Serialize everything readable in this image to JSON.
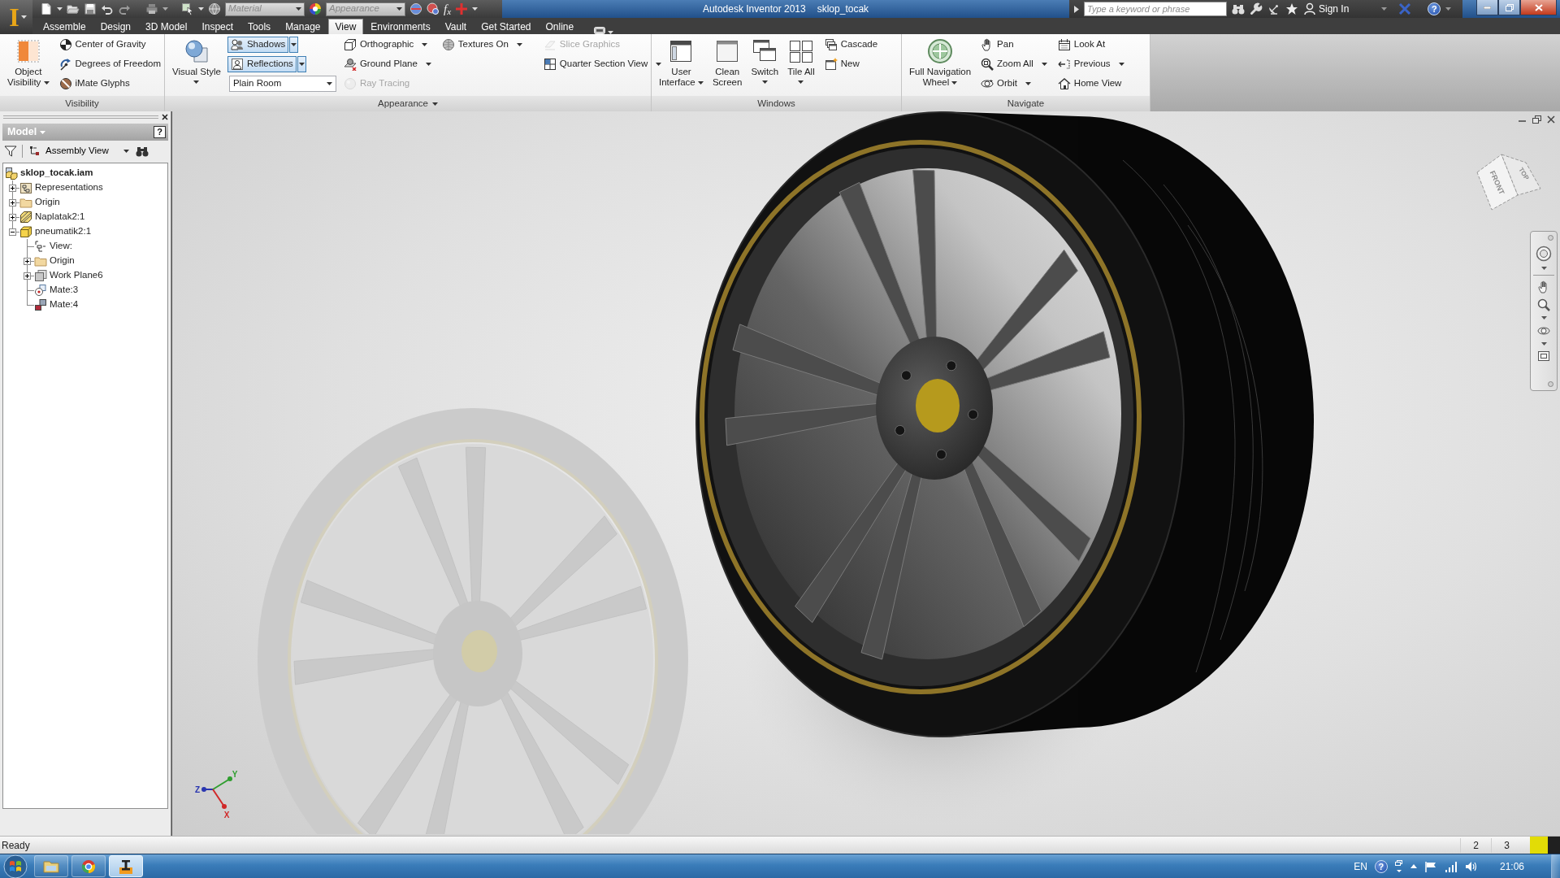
{
  "title_bar": {
    "logo": "I",
    "material": {
      "text": "Material",
      "disabled": true
    },
    "appearance": {
      "text": "Appearance",
      "disabled": true
    },
    "formula": "f$_{x}$",
    "title": "Autodesk Inventor 2013",
    "document": "sklop_tocak",
    "search": {
      "placeholder": "Type a keyword or phrase"
    },
    "sign_in": "Sign In",
    "help": "?"
  },
  "ribbon_tabs": [
    {
      "label": "Assemble",
      "selected": false
    },
    {
      "label": "Design",
      "selected": false
    },
    {
      "label": "3D Model",
      "selected": false
    },
    {
      "label": "Inspect",
      "selected": false
    },
    {
      "label": "Tools",
      "selected": false
    },
    {
      "label": "Manage",
      "selected": false
    },
    {
      "label": "View",
      "selected": true
    },
    {
      "label": "Environments",
      "selected": false
    },
    {
      "label": "Vault",
      "selected": false
    },
    {
      "label": "Get Started",
      "selected": false
    },
    {
      "label": "Online",
      "selected": false
    }
  ],
  "ribbon_panels": [
    {
      "title": "Visibility",
      "menu": false,
      "groups": [
        {
          "kind": "large",
          "lines": [
            "Object",
            "Visibility"
          ],
          "dropdown": true,
          "disabled": false
        },
        {
          "kind": "column",
          "rows": [
            {
              "kind": "button",
              "label": "Center of Gravity",
              "dropdown": false,
              "pressed": false,
              "disabled": false
            },
            {
              "kind": "button",
              "label": "Degrees of Freedom",
              "dropdown": false,
              "pressed": false,
              "disabled": false
            },
            {
              "kind": "button",
              "label": "iMate Glyphs",
              "dropdown": false,
              "pressed": false,
              "disabled": false
            }
          ]
        }
      ]
    },
    {
      "title": "Appearance",
      "menu": true,
      "groups": [
        {
          "kind": "large",
          "lines": [
            "Visual Style"
          ],
          "dropdown": true,
          "disabled": false
        },
        {
          "kind": "column",
          "rows": [
            {
              "kind": "split",
              "label": "Shadows",
              "pressed": true,
              "disabled": false
            },
            {
              "kind": "split",
              "label": "Reflections",
              "pressed": true,
              "disabled": false
            },
            {
              "kind": "combo",
              "value": "Plain Room"
            }
          ]
        },
        {
          "kind": "column",
          "rows": [
            {
              "kind": "button",
              "label": "Orthographic",
              "dropdown": true,
              "pressed": false,
              "disabled": false
            },
            {
              "kind": "button",
              "label": "Ground Plane",
              "dropdown": true,
              "pressed": false,
              "disabled": false
            },
            {
              "kind": "button",
              "label": "Ray Tracing",
              "dropdown": false,
              "pressed": false,
              "disabled": true
            }
          ]
        },
        {
          "kind": "column",
          "rows": [
            {
              "kind": "button",
              "label": "Textures On",
              "dropdown": true,
              "pressed": false,
              "disabled": false
            }
          ]
        },
        {
          "kind": "separator"
        },
        {
          "kind": "column",
          "rows": [
            {
              "kind": "button",
              "label": "Slice Graphics",
              "dropdown": false,
              "pressed": false,
              "disabled": true
            },
            {
              "kind": "button",
              "label": "Quarter Section View",
              "dropdown": true,
              "pressed": false,
              "disabled": false
            }
          ]
        }
      ]
    },
    {
      "title": "Windows",
      "menu": false,
      "groups": [
        {
          "kind": "large",
          "lines": [
            "User",
            "Interface"
          ],
          "dropdown": true,
          "disabled": false
        },
        {
          "kind": "large",
          "lines": [
            "Clean",
            "Screen"
          ],
          "dropdown": false,
          "disabled": false
        },
        {
          "kind": "large",
          "lines": [
            "Switch"
          ],
          "dropdown": true,
          "disabled": false
        },
        {
          "kind": "large",
          "lines": [
            "Tile All"
          ],
          "dropdown": true,
          "disabled": false
        },
        {
          "kind": "column",
          "rows": [
            {
              "kind": "button",
              "label": "Cascade",
              "dropdown": false,
              "pressed": false,
              "disabled": false
            },
            {
              "kind": "button",
              "label": "New",
              "dropdown": false,
              "pressed": false,
              "disabled": false
            }
          ]
        }
      ]
    },
    {
      "title": "Navigate",
      "menu": false,
      "groups": [
        {
          "kind": "large",
          "lines": [
            "Full Navigation",
            "Wheel"
          ],
          "dropdown": true,
          "disabled": false
        },
        {
          "kind": "column",
          "rows": [
            {
              "kind": "button",
              "label": "Pan",
              "dropdown": false,
              "pressed": false,
              "disabled": false
            },
            {
              "kind": "button",
              "label": "Zoom All",
              "dropdown": true,
              "pressed": false,
              "disabled": false
            },
            {
              "kind": "button",
              "label": "Orbit",
              "dropdown": true,
              "pressed": false,
              "disabled": false
            }
          ]
        },
        {
          "kind": "column",
          "rows": [
            {
              "kind": "button",
              "label": "Look At",
              "dropdown": false,
              "pressed": false,
              "disabled": false
            },
            {
              "kind": "button",
              "label": "Previous",
              "dropdown": true,
              "pressed": false,
              "disabled": false
            },
            {
              "kind": "button",
              "label": "Home View",
              "dropdown": false,
              "pressed": false,
              "disabled": false
            }
          ]
        }
      ]
    }
  ],
  "browser": {
    "title": "Model",
    "help": "?",
    "view": "Assembly View",
    "tree": [
      {
        "label": "sklop_tocak.iam",
        "kind": "assembly",
        "children": [
          {
            "label": "Representations",
            "kind": "representations",
            "expanded": false
          },
          {
            "label": "Origin",
            "kind": "folder",
            "expanded": false
          },
          {
            "label": "Naplatak2:1",
            "kind": "part-hatched",
            "expanded": false
          },
          {
            "label": "pneumatik2:1",
            "kind": "part",
            "expanded": true,
            "children": [
              {
                "label": "View:",
                "kind": "view"
              },
              {
                "label": "Origin",
                "kind": "folder",
                "expanded": false
              },
              {
                "label": "Work Plane6",
                "kind": "work-plane",
                "expanded": false
              },
              {
                "label": "Mate:3",
                "kind": "mate"
              },
              {
                "label": "Mate:4",
                "kind": "flush"
              }
            ]
          }
        ]
      }
    ]
  },
  "viewport": {
    "view_cube": {
      "faces": [
        "FRONT",
        "TOP"
      ]
    },
    "axes": [
      {
        "label": "Z",
        "color": "#2a36b0"
      },
      {
        "label": "Y",
        "color": "#2f9e2f"
      },
      {
        "label": "X",
        "color": "#d02828"
      }
    ]
  },
  "status_bar": {
    "text": "Ready",
    "cells": [
      "2",
      "3"
    ]
  },
  "taskbar": {
    "pinned": [
      {
        "selected": false
      },
      {
        "selected": false
      },
      {
        "selected": true
      }
    ],
    "language": "EN",
    "help": "?",
    "clock": "21:06"
  }
}
